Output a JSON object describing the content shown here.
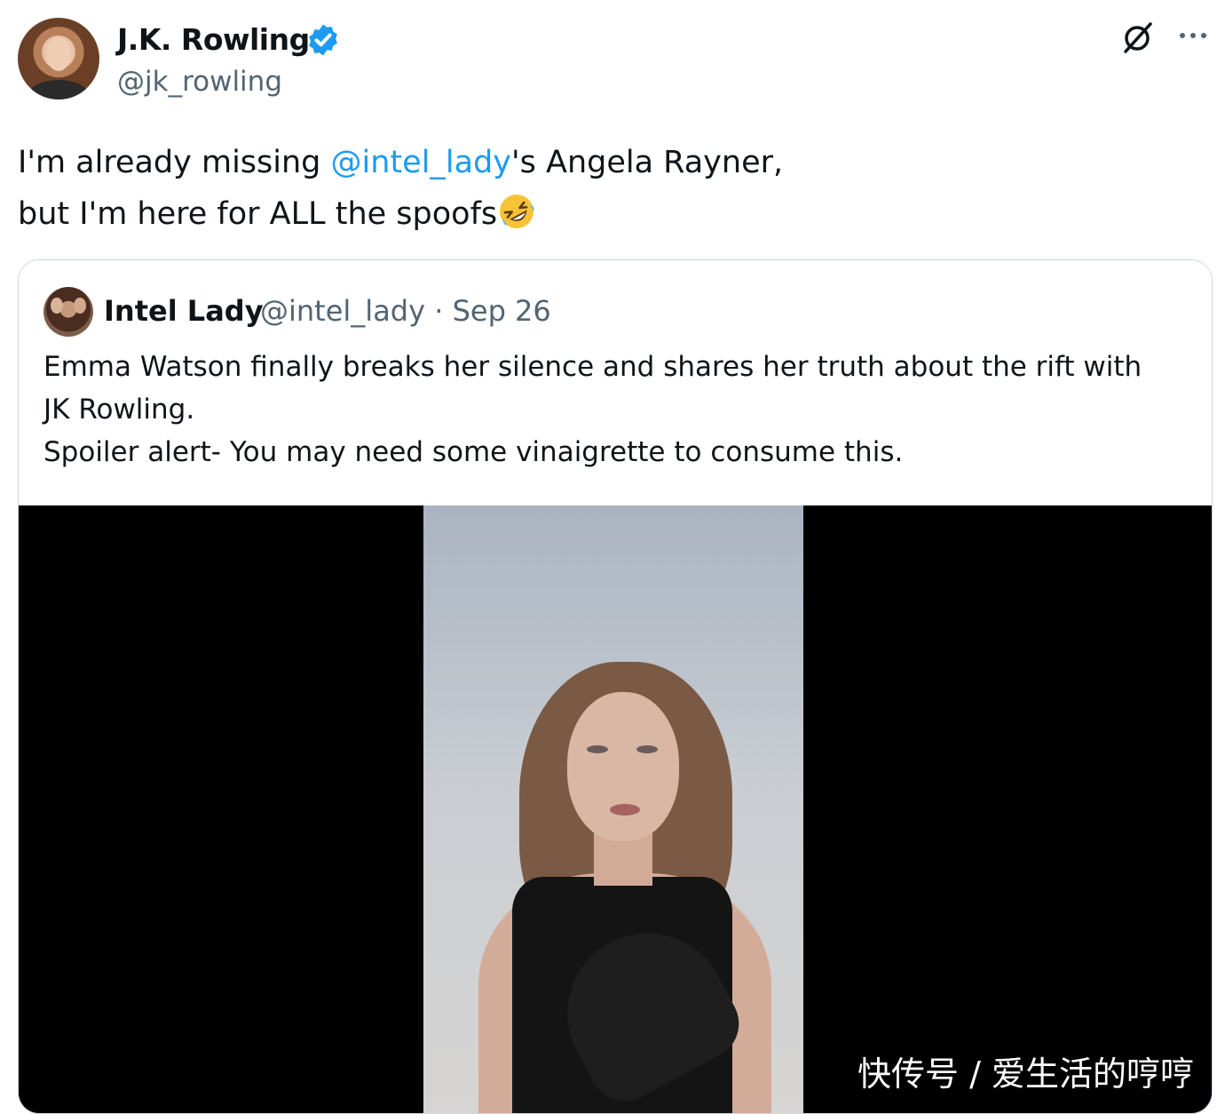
{
  "author": {
    "name": "J.K. Rowling",
    "handle": "@jk_rowling",
    "verified": true
  },
  "icons": {
    "verified": "verified-badge-icon",
    "grok": "grok-icon",
    "more": "more-options-icon",
    "emoji": "rolling-on-the-floor-laughing-emoji"
  },
  "tweet": {
    "line1_before": "I'm already missing ",
    "mention": "@intel_lady",
    "line1_after": "'s Angela Rayner,",
    "line2": "but I'm here for ALL the spoofs"
  },
  "quoted": {
    "name": "Intel Lady",
    "handle": "@intel_lady",
    "separator": "·",
    "date": "Sep 26",
    "text_lines": [
      "Emma Watson finally breaks her silence and shares her truth about the rift with",
      "JK Rowling.",
      "Spoiler alert- You may need some vinaigrette to consume this."
    ]
  },
  "watermark": "快传号 / 爱生活的哼哼",
  "colors": {
    "link": "#1d9bf0",
    "verified": "#1d9bf0",
    "secondary_text": "#536471",
    "border": "#cfd9de"
  }
}
